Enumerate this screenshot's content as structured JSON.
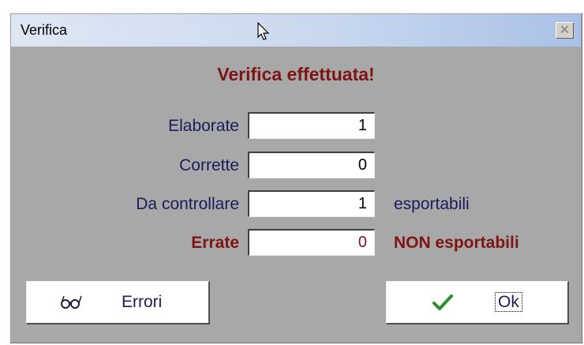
{
  "window": {
    "title": "Verifica"
  },
  "heading": "Verifica effettuata!",
  "rows": [
    {
      "label": "Elaborate",
      "value": "1",
      "suffix": ""
    },
    {
      "label": "Corrette",
      "value": "0",
      "suffix": ""
    },
    {
      "label": "Da controllare",
      "value": "1",
      "suffix": "esportabili"
    },
    {
      "label": "Errate",
      "value": "0",
      "suffix": "NON esportabili"
    }
  ],
  "buttons": {
    "errori_label": "Errori",
    "ok_label": "Ok"
  },
  "icons": {
    "close": "close-icon",
    "errori": "glasses-icon",
    "ok": "checkmark-icon",
    "cursor": "mouse-cursor-icon"
  },
  "colors": {
    "heading": "#7e1414",
    "error": "#7e1414",
    "text": "#1c1c5c",
    "background": "#a8a8a8",
    "ok_check": "#2e8b2e"
  }
}
